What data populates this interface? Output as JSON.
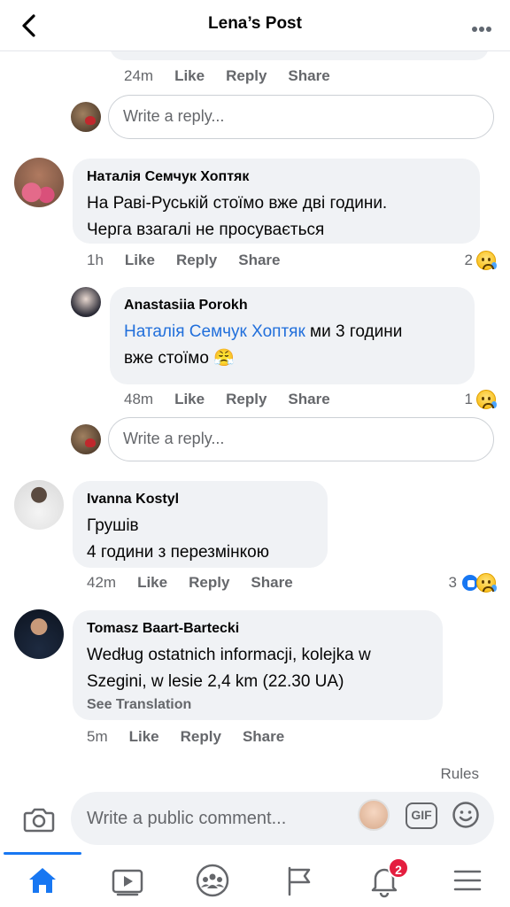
{
  "header": {
    "title": "Lena’s Post",
    "back_icon": "chevron-left-icon",
    "more_icon": "more-horizontal-icon"
  },
  "action_labels": {
    "like": "Like",
    "reply": "Reply",
    "share": "Share"
  },
  "reply_placeholder": "Write a reply...",
  "feed": {
    "top_actions_time": "24m",
    "comments": [
      {
        "author": "Наталія Семчук Хоптяк",
        "text_line1": "На  Раві-Руській  стоїмо вже  дві години.",
        "text_line2": "Черга взагалі не просувається",
        "time": "1h",
        "reaction_count": "2",
        "reactions": [
          "sad"
        ],
        "reply": {
          "author": "Anastasiia Porokh",
          "mention": "Наталія Семчук Хоптяк",
          "text_after_mention": " ми 3 години",
          "text_line2": "вже стоїмо 😤",
          "time": "48m",
          "reaction_count": "1",
          "reactions": [
            "sad"
          ]
        }
      },
      {
        "author": "Ivanna Kostyl",
        "text_line1": "Грушів",
        "text_line2": "4 години з перезмінкою",
        "time": "42m",
        "reaction_count": "3",
        "reactions": [
          "like",
          "sad"
        ]
      },
      {
        "author": "Tomasz Baart-Bartecki",
        "text_line1": "Według ostatnich informacji, kolejka w",
        "text_line2": "Szegini, w lesie 2,4 km (22.30 UA)",
        "see_translation": "See Translation",
        "time": "5m"
      }
    ]
  },
  "rules_label": "Rules",
  "composer": {
    "placeholder": "Write a public comment...",
    "camera_icon": "camera-icon",
    "gif_label": "GIF",
    "emoji_icon": "smiley-icon"
  },
  "tabbar": {
    "tabs": [
      "home",
      "watch",
      "groups",
      "pages",
      "notifications",
      "menu"
    ],
    "active_tab": "home",
    "notifications_badge": "2"
  },
  "colors": {
    "accent": "#1877f2",
    "bubble": "#f0f2f5",
    "secondary_text": "#65676b",
    "mention": "#216fdb",
    "badge": "#e41e3f"
  }
}
